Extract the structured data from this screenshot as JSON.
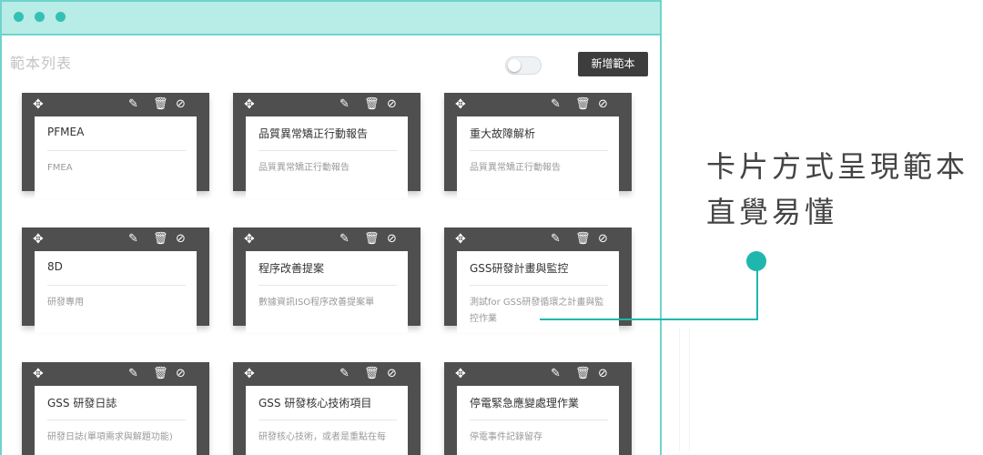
{
  "page": {
    "title": "範本列表",
    "add_button": "新增範本"
  },
  "toggle": {
    "on": false
  },
  "card_actions": {
    "move": "✥",
    "edit": "✎",
    "delete": "🗑",
    "hide": "⊘"
  },
  "cards": [
    {
      "title": "PFMEA",
      "desc": "FMEA"
    },
    {
      "title": "品質異常矯正行動報告",
      "desc": "品質異常矯正行動報告"
    },
    {
      "title": "重大故障解析",
      "desc": "品質異常矯正行動報告"
    },
    {
      "title": "8D",
      "desc": "研發專用"
    },
    {
      "title": "程序改善提案",
      "desc": "數據資訊ISO程序改善提案單"
    },
    {
      "title": "GSS研發計畫與監控",
      "desc": "測試for GSS研發循環之計畫與監控作業"
    },
    {
      "title": "GSS 研發日誌",
      "desc": "研發日誌(單項需求與解題功能)"
    },
    {
      "title": "GSS 研發核心技術項目",
      "desc": "研發核心技術，或者是重點在每"
    },
    {
      "title": "停電緊急應變處理作業",
      "desc": "停電事件記錄留存"
    }
  ],
  "callout": {
    "line1": "卡片方式呈現範本",
    "line2": "直覺易懂"
  },
  "colors": {
    "accent": "#1fb7ad",
    "titlebar": "#b8ece7",
    "card_frame": "#4f4f4f"
  }
}
